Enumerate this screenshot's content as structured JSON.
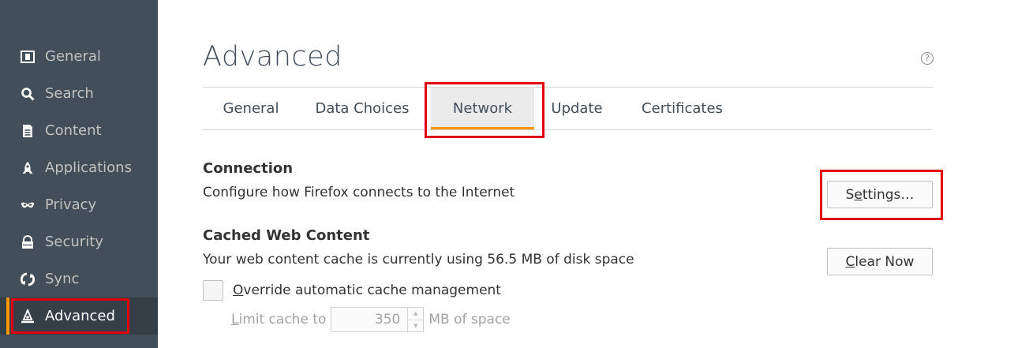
{
  "sidebar": {
    "items": [
      {
        "label": "General",
        "icon": "general-icon"
      },
      {
        "label": "Search",
        "icon": "search-icon"
      },
      {
        "label": "Content",
        "icon": "content-icon"
      },
      {
        "label": "Applications",
        "icon": "applications-icon"
      },
      {
        "label": "Privacy",
        "icon": "privacy-mask-icon"
      },
      {
        "label": "Security",
        "icon": "security-lock-icon"
      },
      {
        "label": "Sync",
        "icon": "sync-icon"
      },
      {
        "label": "Advanced",
        "icon": "advanced-icon"
      }
    ],
    "selected": "Advanced"
  },
  "page": {
    "title": "Advanced",
    "help_icon": "?"
  },
  "tabs": [
    {
      "label": "General"
    },
    {
      "label": "Data Choices"
    },
    {
      "label": "Network"
    },
    {
      "label": "Update"
    },
    {
      "label": "Certificates"
    }
  ],
  "active_tab": "Network",
  "connection": {
    "heading": "Connection",
    "description": "Configure how Firefox connects to the Internet",
    "settings_button": {
      "prefix": "S",
      "access_key": "e",
      "suffix": "ttings…"
    }
  },
  "cache": {
    "heading": "Cached Web Content",
    "description": "Your web content cache is currently using 56.5 MB of disk space",
    "clear_button": {
      "prefix": "",
      "access_key": "C",
      "suffix": "lear Now"
    },
    "override_label": {
      "access_key": "O",
      "rest": "verride automatic cache management"
    },
    "override_checked": false,
    "limit_label": {
      "access_key": "L",
      "rest": "imit cache to"
    },
    "limit_value": "350",
    "limit_suffix": "MB of space"
  },
  "colors": {
    "sidebar_bg": "#424f5a",
    "sidebar_selected_bg": "#343f48",
    "accent": "#ff9500",
    "highlight_red": "#e2000f"
  }
}
